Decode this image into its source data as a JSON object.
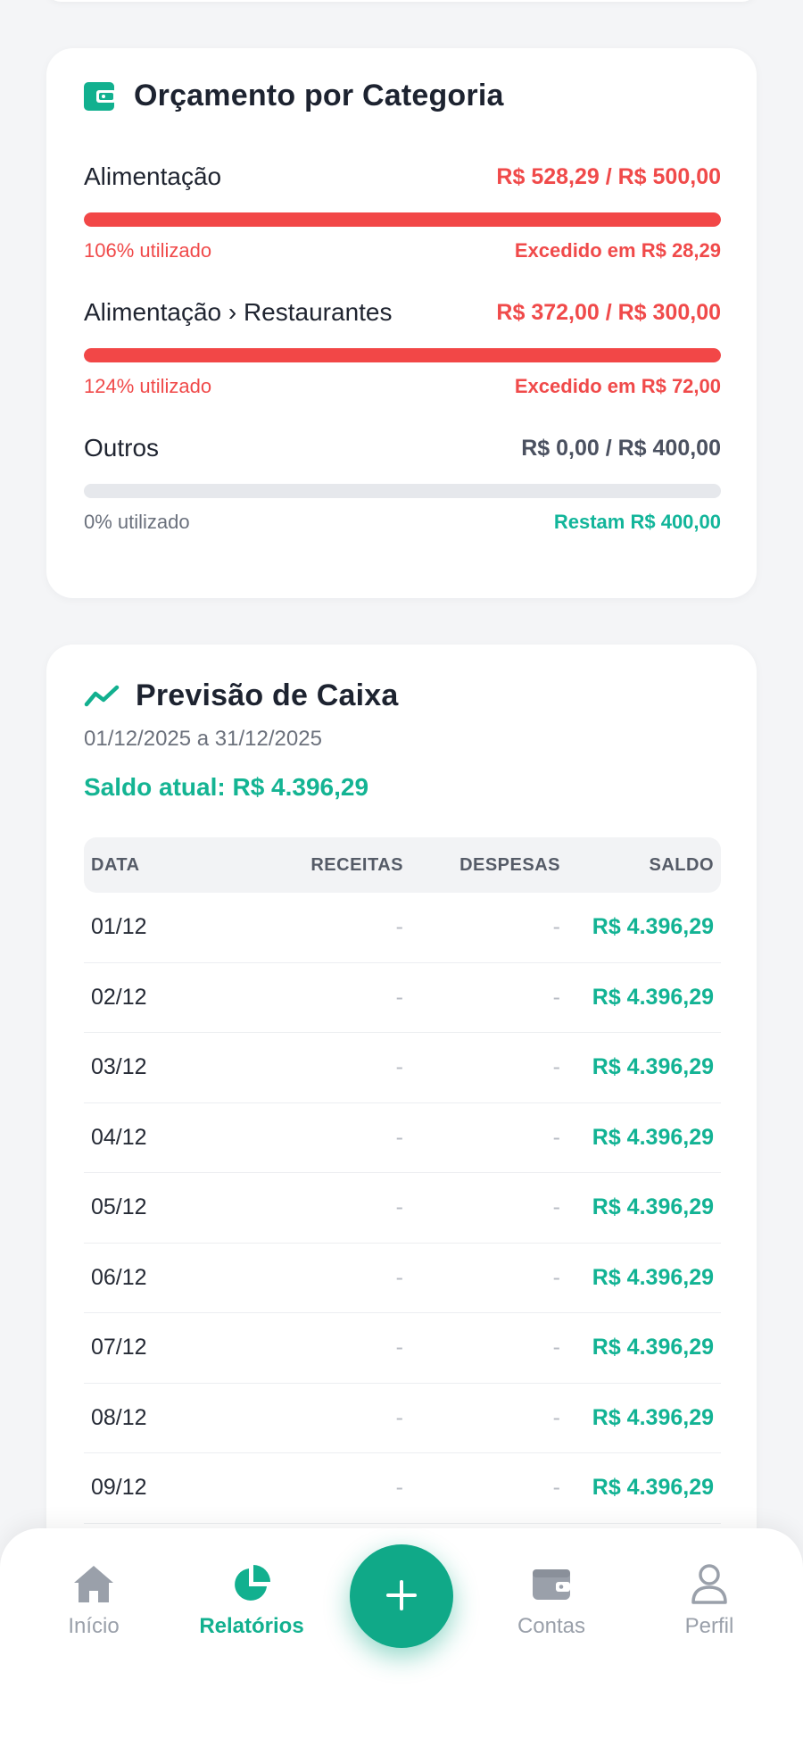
{
  "budget": {
    "title": "Orçamento por Categoria",
    "icon": "wallet-icon",
    "items": [
      {
        "name": "Alimentação",
        "amount": "R$ 528,29 / R$ 500,00",
        "percent_text": "106% utilizado",
        "note": "Excedido em R$ 28,29",
        "used_fraction": 1.0,
        "status": "over"
      },
      {
        "name": "Alimentação › Restaurantes",
        "amount": "R$ 372,00 / R$ 300,00",
        "percent_text": "124% utilizado",
        "note": "Excedido em R$ 72,00",
        "used_fraction": 1.0,
        "status": "over"
      },
      {
        "name": "Outros",
        "amount": "R$ 0,00 / R$ 400,00",
        "percent_text": "0% utilizado",
        "note": "Restam R$ 400,00",
        "used_fraction": 0.0,
        "status": "ok"
      }
    ]
  },
  "forecast": {
    "title": "Previsão de Caixa",
    "icon": "trend-line-icon",
    "period": "01/12/2025 a 31/12/2025",
    "current_balance": "Saldo atual: R$ 4.396,29",
    "columns": [
      "DATA",
      "RECEITAS",
      "DESPESAS",
      "SALDO"
    ],
    "rows": [
      {
        "date": "01/12",
        "receitas": "-",
        "despesas": "-",
        "saldo": "R$ 4.396,29"
      },
      {
        "date": "02/12",
        "receitas": "-",
        "despesas": "-",
        "saldo": "R$ 4.396,29"
      },
      {
        "date": "03/12",
        "receitas": "-",
        "despesas": "-",
        "saldo": "R$ 4.396,29"
      },
      {
        "date": "04/12",
        "receitas": "-",
        "despesas": "-",
        "saldo": "R$ 4.396,29"
      },
      {
        "date": "05/12",
        "receitas": "-",
        "despesas": "-",
        "saldo": "R$ 4.396,29"
      },
      {
        "date": "06/12",
        "receitas": "-",
        "despesas": "-",
        "saldo": "R$ 4.396,29"
      },
      {
        "date": "07/12",
        "receitas": "-",
        "despesas": "-",
        "saldo": "R$ 4.396,29"
      },
      {
        "date": "08/12",
        "receitas": "-",
        "despesas": "-",
        "saldo": "R$ 4.396,29"
      },
      {
        "date": "09/12",
        "receitas": "-",
        "despesas": "-",
        "saldo": "R$ 4.396,29"
      }
    ]
  },
  "nav": {
    "items": [
      {
        "label": "Início",
        "icon": "home-icon",
        "active": false
      },
      {
        "label": "Relatórios",
        "icon": "pie-chart-icon",
        "active": true
      },
      {
        "label": "Contas",
        "icon": "wallet-icon",
        "active": false
      },
      {
        "label": "Perfil",
        "icon": "user-icon",
        "active": false
      }
    ],
    "fab_icon": "plus-icon"
  },
  "colors": {
    "accent": "#12b08f",
    "danger": "#f04a4a",
    "muted": "#9aa0aa",
    "background": "#f4f5f7"
  }
}
